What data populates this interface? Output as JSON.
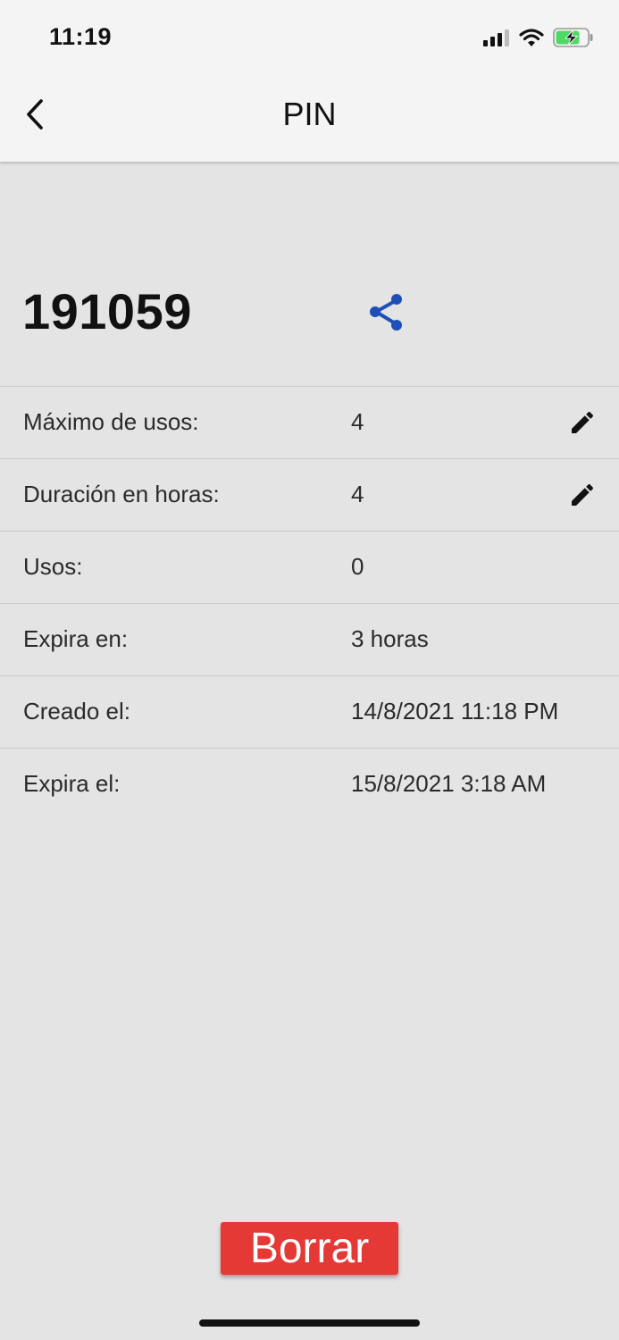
{
  "status_bar": {
    "time": "11:19",
    "icons": [
      "cellular-signal-icon",
      "wifi-icon",
      "battery-charging-icon"
    ],
    "battery_color": "#4cd964"
  },
  "nav": {
    "title": "PIN",
    "back_icon": "chevron-left-icon"
  },
  "pin": {
    "code": "191059",
    "share_icon": "share-icon",
    "share_color": "#1e4fb8"
  },
  "details": {
    "max_uses_label": "Máximo de usos:",
    "max_uses_value": "4",
    "duration_label": "Duración en horas:",
    "duration_value": "4",
    "uses_label": "Usos:",
    "uses_value": "0",
    "expires_in_label": "Expira en:",
    "expires_in_value": "3 horas",
    "created_label": "Creado el:",
    "created_value": "14/8/2021 11:18 PM",
    "expires_at_label": "Expira el:",
    "expires_at_value": "15/8/2021 3:18 AM",
    "edit_icon": "pencil-icon"
  },
  "actions": {
    "delete_label": "Borrar",
    "delete_color": "#e53935"
  }
}
